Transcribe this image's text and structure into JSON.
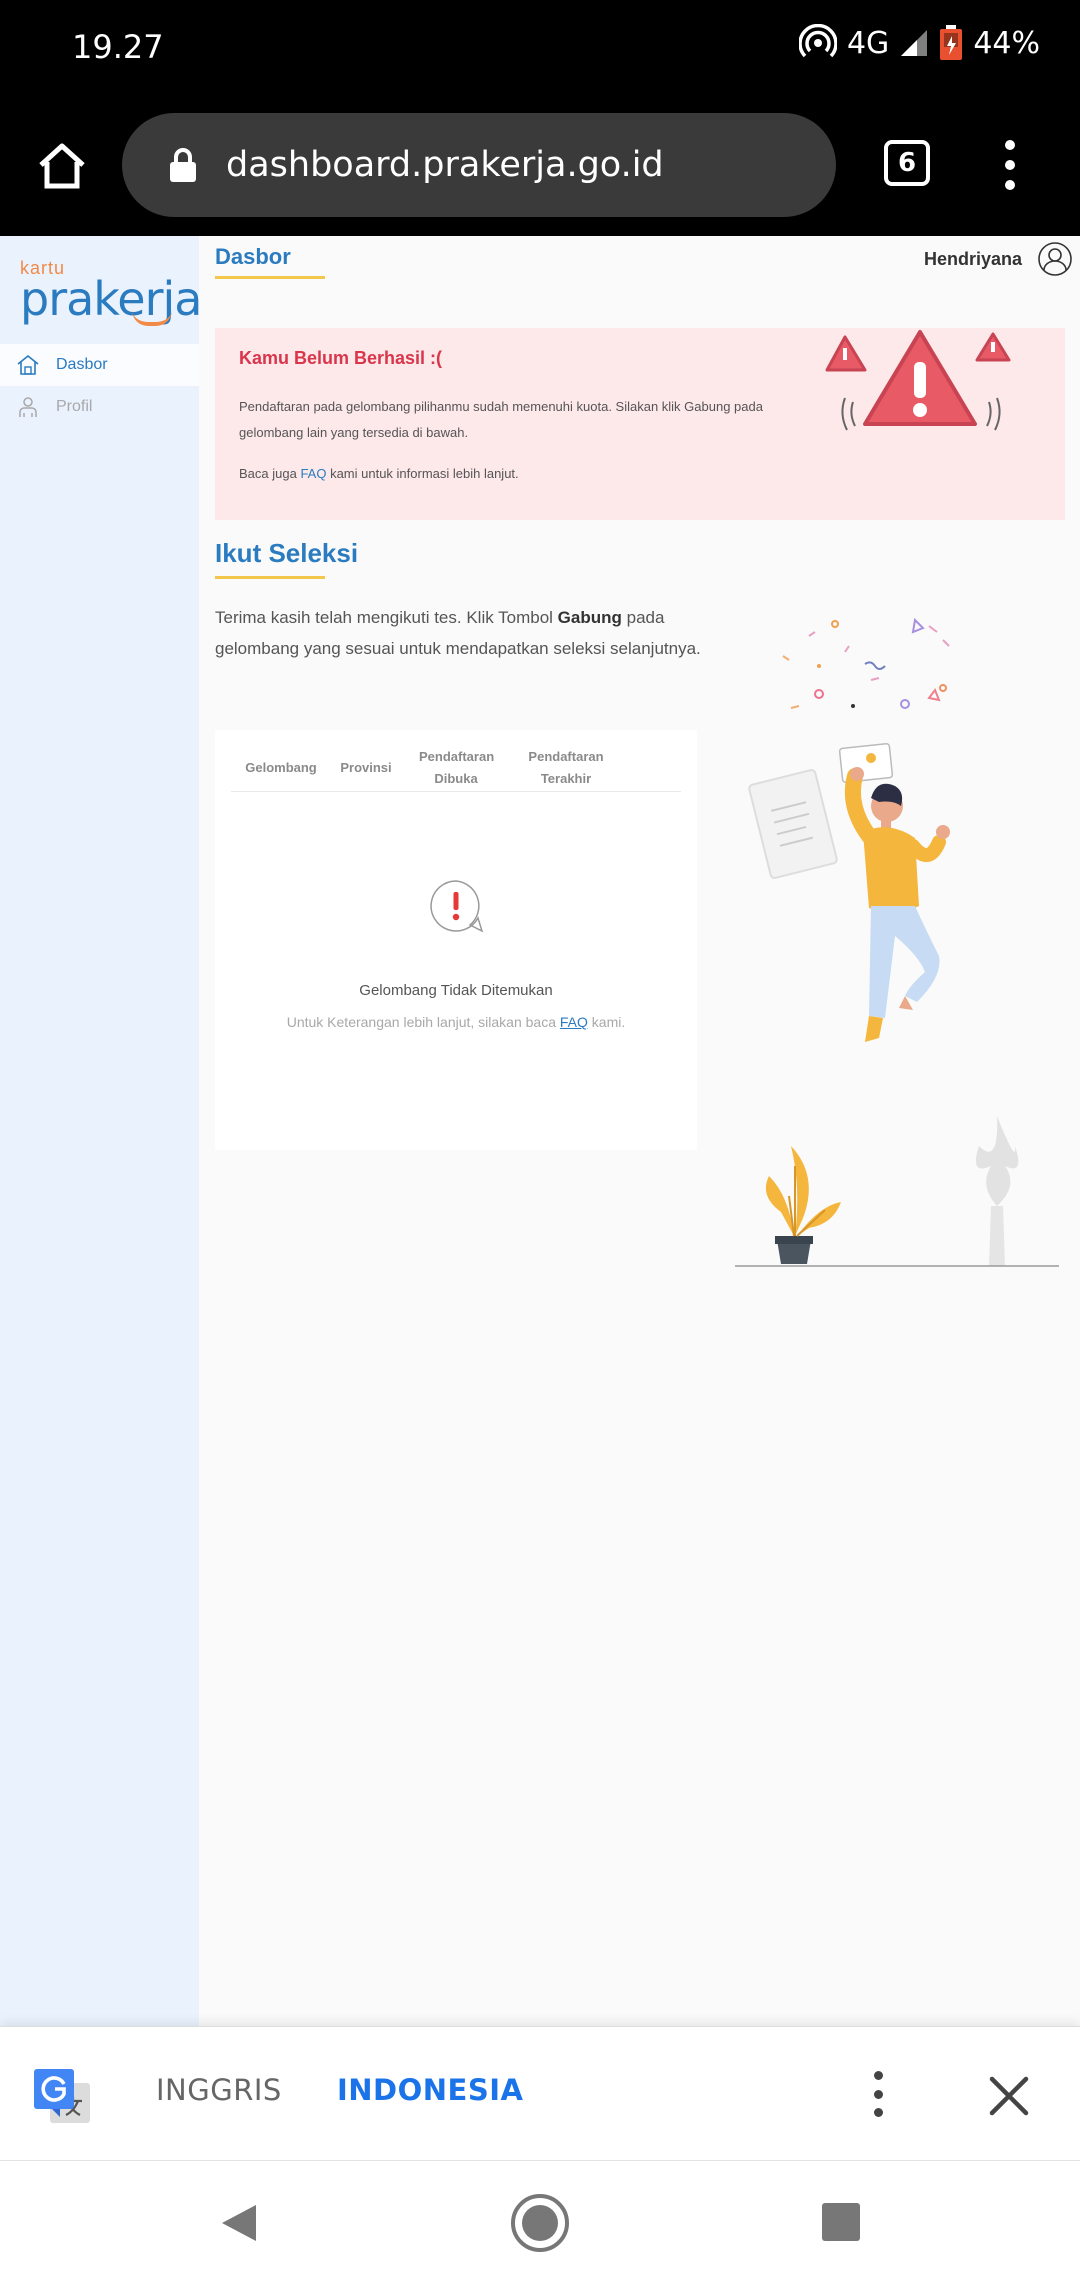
{
  "status_bar": {
    "time": "19.27",
    "network": "4G",
    "battery": "44%"
  },
  "browser": {
    "url": "dashboard.prakerja.go.id",
    "tab_count": "6"
  },
  "logo": {
    "line1": "kartu",
    "line2": "prakerja"
  },
  "sidebar": {
    "items": [
      {
        "label": "Dasbor",
        "icon": "home-icon",
        "active": true
      },
      {
        "label": "Profil",
        "icon": "profile-icon",
        "active": false
      }
    ]
  },
  "header": {
    "breadcrumb": "Dasbor",
    "username": "Hendriyana"
  },
  "alert": {
    "title": "Kamu Belum Berhasil :(",
    "body": "Pendaftaran pada gelombang pilihanmu sudah memenuhi kuota. Silakan klik Gabung pada gelombang lain yang tersedia di bawah.",
    "faq_prefix": "Baca juga ",
    "faq_link": "FAQ",
    "faq_suffix": " kami untuk informasi lebih lanjut."
  },
  "section": {
    "title": "Ikut Seleksi",
    "intro_prefix": "Terima kasih telah mengikuti tes. Klik Tombol ",
    "intro_bold": "Gabung",
    "intro_suffix": " pada gelombang yang sesuai untuk mendapatkan seleksi selanjutnya."
  },
  "table": {
    "columns": [
      "Gelombang",
      "Provinsi",
      "Pendaftaran Dibuka",
      "Pendaftaran Terakhir"
    ],
    "empty_title": "Gelombang Tidak Ditemukan",
    "empty_sub_prefix": "Untuk Keterangan lebih lanjut, silakan baca ",
    "empty_sub_link": "FAQ",
    "empty_sub_suffix": " kami."
  },
  "translate_bar": {
    "source_lang": "INGGRIS",
    "target_lang": "INDONESIA"
  },
  "colors": {
    "brand_blue": "#2a7bc0",
    "accent_orange": "#f18a46",
    "alert_bg": "#fde8ea",
    "alert_text": "#d9364b",
    "translate_active": "#1a73e8"
  }
}
